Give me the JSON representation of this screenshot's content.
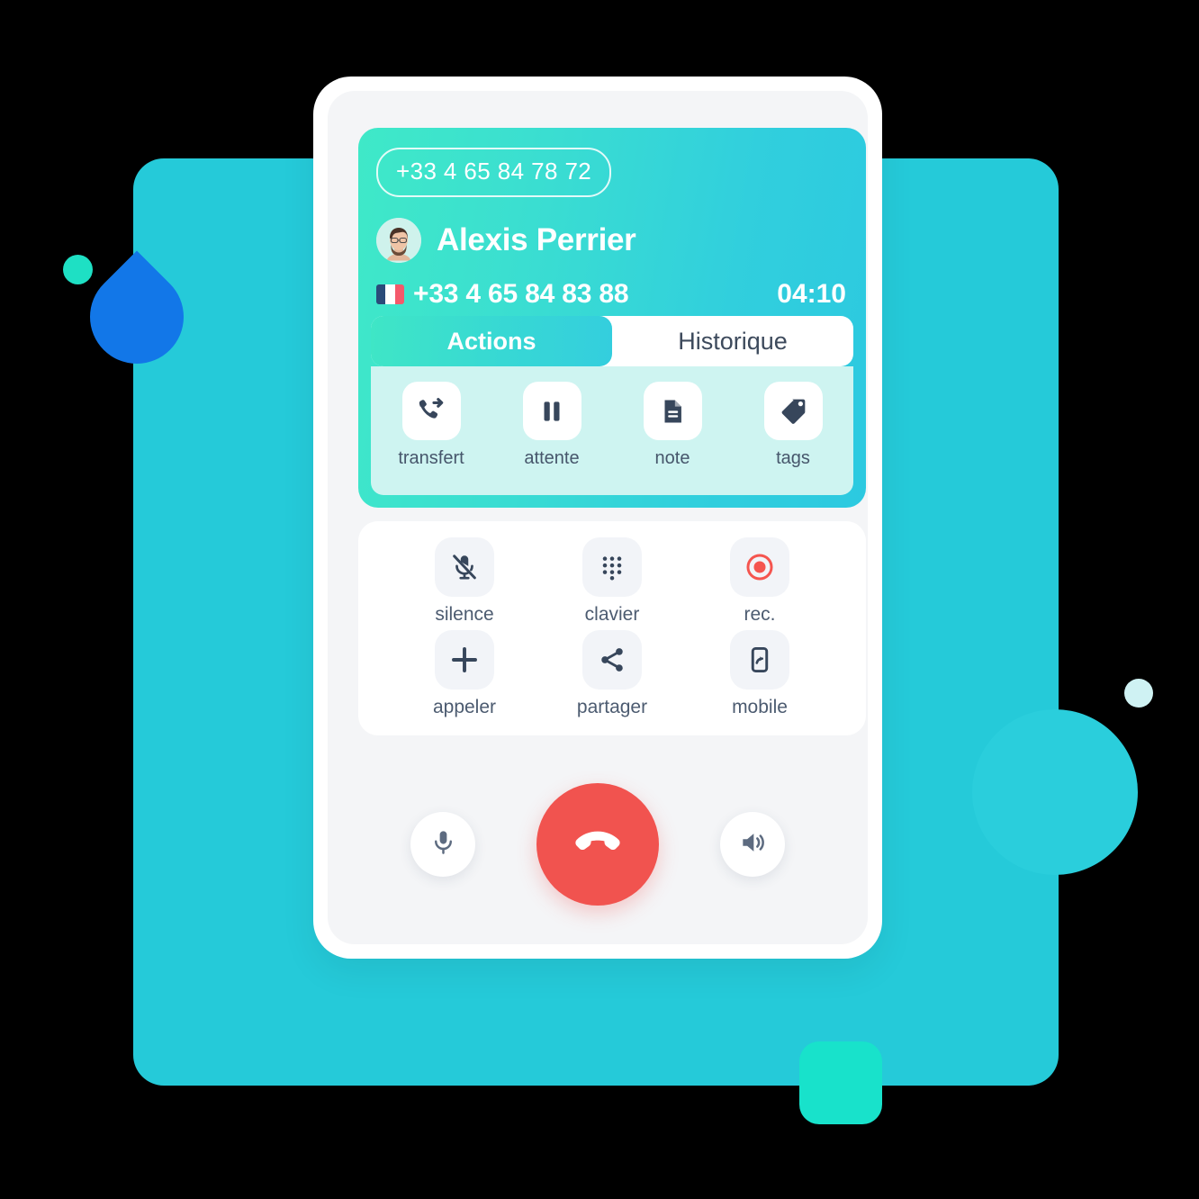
{
  "call": {
    "dialed_number": "+33 4 65 84 78 72",
    "contact_name": "Alexis Perrier",
    "contact_number": "+33 4 65 84 83 88",
    "duration": "04:10",
    "flag": "fr-flag-icon",
    "avatar": "contact-avatar"
  },
  "tabs": [
    {
      "label": "Actions",
      "active": true
    },
    {
      "label": "Historique",
      "active": false
    }
  ],
  "actions": [
    {
      "label": "transfert",
      "icon": "call-transfer-icon"
    },
    {
      "label": "attente",
      "icon": "pause-icon"
    },
    {
      "label": "note",
      "icon": "document-icon"
    },
    {
      "label": "tags",
      "icon": "tag-icon"
    }
  ],
  "controls": [
    {
      "label": "silence",
      "icon": "microphone-muted-icon"
    },
    {
      "label": "clavier",
      "icon": "dialpad-icon"
    },
    {
      "label": "rec.",
      "icon": "record-icon"
    },
    {
      "label": "appeler",
      "icon": "plus-icon"
    },
    {
      "label": "partager",
      "icon": "share-icon"
    },
    {
      "label": "mobile",
      "icon": "mobile-transfer-icon"
    }
  ],
  "bottom_bar": {
    "mic": {
      "icon": "microphone-icon"
    },
    "hangup": {
      "icon": "hangup-phone-icon"
    },
    "speaker": {
      "icon": "speaker-icon"
    }
  },
  "colors": {
    "background": "#000000",
    "panel": "#25CAD9",
    "gradient_start": "#3FE9C8",
    "gradient_end": "#2CC9E0",
    "actions_panel": "#CEF4F1",
    "hangup": "#F1534F",
    "record": "#F5554F",
    "icon_dark": "#37465B",
    "square": "#18E2CB",
    "leaf": "#1277E8"
  }
}
